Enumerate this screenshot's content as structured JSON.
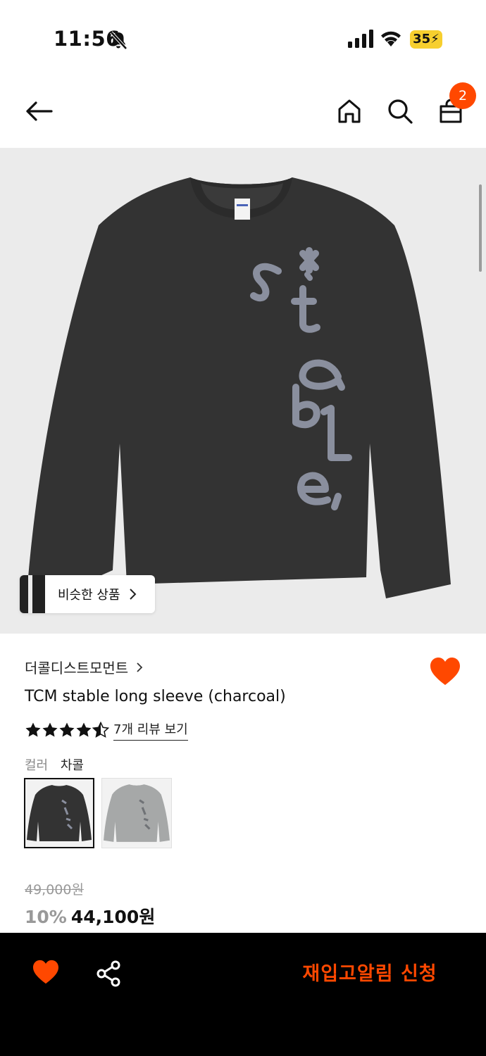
{
  "status_bar": {
    "time": "11:56",
    "battery": "35"
  },
  "header": {
    "cart_count": "2"
  },
  "product": {
    "similar_label": "비슷한 상품",
    "brand": "더콜디스트모먼트",
    "title": "TCM stable long sleeve (charcoal)",
    "rating": 4.5,
    "review_link": "7개 리뷰 보기",
    "color_label": "컬러",
    "color_value": "차콜",
    "original_price": "49,000원",
    "discount": "10%",
    "sale_price": "44,100원",
    "liked": true
  },
  "colors": {
    "accent": "#ff4800",
    "garment_dark": "#333333",
    "garment_light": "#a6a8a8",
    "print": "#8a8f9e"
  },
  "bottom_bar": {
    "restock_label": "재입고알림 신청"
  }
}
